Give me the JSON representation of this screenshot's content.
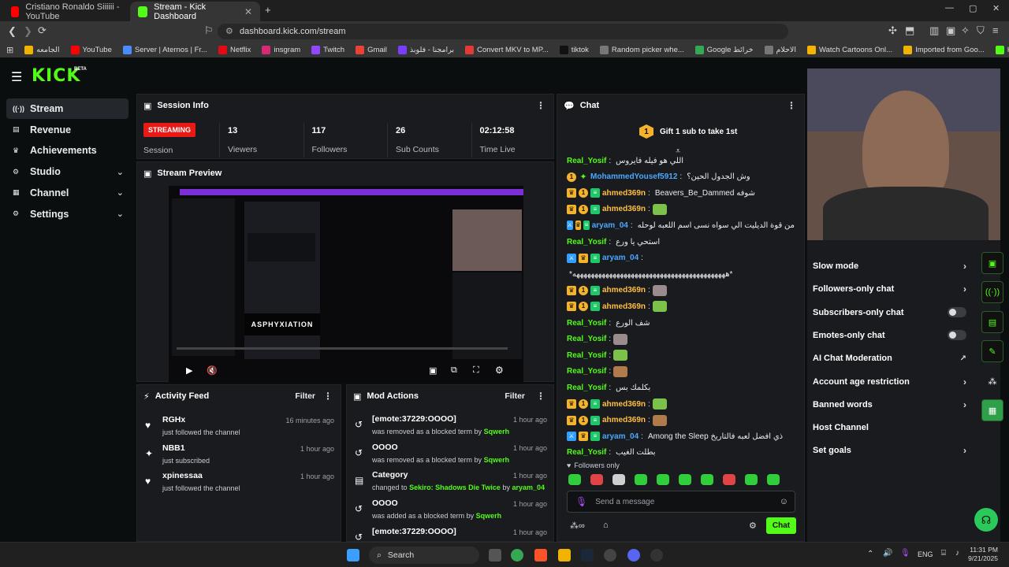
{
  "browser": {
    "tabs": [
      {
        "title": "Cristiano Ronaldo Siiiiii - YouTube",
        "active": false,
        "color": "#ff0000"
      },
      {
        "title": "Stream - Kick Dashboard",
        "active": true,
        "color": "#53fc18"
      }
    ],
    "new_tab": "+",
    "url": "dashboard.kick.com/stream",
    "bookmarks": [
      {
        "label": "الجامعه",
        "color": "#f0b400"
      },
      {
        "label": "YouTube",
        "color": "#ff0000"
      },
      {
        "label": "Server | Aternos | Fr...",
        "color": "#4a8cff"
      },
      {
        "label": "Netflix",
        "color": "#e50914"
      },
      {
        "label": "insgram",
        "color": "#d62976"
      },
      {
        "label": "Twitch",
        "color": "#9146ff"
      },
      {
        "label": "Gmail",
        "color": "#ea4335"
      },
      {
        "label": "برامجنا - فلوبذ",
        "color": "#7a3cff"
      },
      {
        "label": "Convert MKV to MP...",
        "color": "#e53935"
      },
      {
        "label": "tiktok",
        "color": "#111111"
      },
      {
        "label": "Random picker whe...",
        "color": "#777777"
      },
      {
        "label": "Google خرائط",
        "color": "#34a853"
      },
      {
        "label": "الاحلام",
        "color": "#777777"
      },
      {
        "label": "Watch Cartoons Onl...",
        "color": "#f4b400"
      },
      {
        "label": "Imported from Goo...",
        "color": "#f0b400"
      },
      {
        "label": "Kick",
        "color": "#53fc18"
      }
    ]
  },
  "app": {
    "logo": "KICK",
    "logo_badge": "BETA",
    "nav": [
      {
        "label": "Stream",
        "icon": "stream-icon",
        "active": true,
        "expandable": false
      },
      {
        "label": "Revenue",
        "icon": "revenue-icon",
        "active": false,
        "expandable": false
      },
      {
        "label": "Achievements",
        "icon": "trophy-icon",
        "active": false,
        "expandable": false
      },
      {
        "label": "Studio",
        "icon": "studio-icon",
        "active": false,
        "expandable": true
      },
      {
        "label": "Channel",
        "icon": "channel-icon",
        "active": false,
        "expandable": true
      },
      {
        "label": "Settings",
        "icon": "gear-icon",
        "active": false,
        "expandable": true
      }
    ],
    "session": {
      "title": "Session Info",
      "status": "STREAMING",
      "status_label": "Session",
      "stats": [
        {
          "value": "13",
          "label": "Viewers"
        },
        {
          "value": "117",
          "label": "Followers"
        },
        {
          "value": "26",
          "label": "Sub Counts"
        },
        {
          "value": "02:12:58",
          "label": "Time Live"
        }
      ]
    },
    "preview": {
      "title": "Stream Preview"
    },
    "activity": {
      "title": "Activity Feed",
      "filter": "Filter",
      "items": [
        {
          "name": "RGHx",
          "desc": "just followed the channel",
          "time": "16 minutes ago",
          "icon": "heart-icon"
        },
        {
          "name": "NBB1",
          "desc": "just subscribed",
          "time": "1 hour ago",
          "icon": "star-icon"
        },
        {
          "name": "xpinessaa",
          "desc": "just followed the channel",
          "time": "1 hour ago",
          "icon": "heart-icon"
        }
      ]
    },
    "mod": {
      "title": "Mod Actions",
      "filter": "Filter",
      "items": [
        {
          "title": "[emote:37229:OOOO]",
          "pre": "was removed as a blocked term by",
          "hl": "",
          "mid": "",
          "user": "Sqwerh",
          "time": "1 hour ago",
          "icon": "undo-icon"
        },
        {
          "title": "OOOO",
          "pre": "was removed as a blocked term by",
          "hl": "",
          "mid": "",
          "user": "Sqwerh",
          "time": "1 hour ago",
          "icon": "undo-icon"
        },
        {
          "title": "Category",
          "pre": "changed to",
          "hl": "Sekiro: Shadows Die Twice",
          "mid": "by",
          "user": "aryam_04",
          "time": "1 hour ago",
          "icon": "category-icon"
        },
        {
          "title": "OOOO",
          "pre": "was added as a blocked term by",
          "hl": "",
          "mid": "",
          "user": "Sqwerh",
          "time": "1 hour ago",
          "icon": "undo-icon"
        },
        {
          "title": "[emote:37229:OOOO]",
          "pre": "",
          "hl": "",
          "mid": "",
          "user": "",
          "time": "1 hour ago",
          "icon": "undo-icon"
        }
      ]
    },
    "chat": {
      "title": "Chat",
      "pinned_num": "1",
      "pinned": "Gift 1 sub to take 1st",
      "followers_only": "Followers only",
      "placeholder": "Send a message",
      "send": "Chat",
      "messages": [
        {
          "user": "Real_Yosif",
          "color": "#53fc18",
          "badges": [],
          "text": "اللي هو فيله فايروس",
          "emotes": 0
        },
        {
          "user": "MohammedYousef5912",
          "color": "#4aa8ff",
          "badges": [
            "gold",
            "sparkle"
          ],
          "text": "وش الجدول الحين؟",
          "emotes": 0
        },
        {
          "user": "ahmed369n",
          "color": "#ffbf3f",
          "badges": [
            "vip",
            "gold",
            "sub"
          ],
          "text": "Beavers_Be_Dammed شوفه",
          "emotes": 0
        },
        {
          "user": "ahmed369n",
          "color": "#ffbf3f",
          "badges": [
            "vip",
            "gold",
            "sub"
          ],
          "text": "",
          "emotes": 1
        },
        {
          "user": "aryam_04",
          "color": "#4aa8ff",
          "badges": [
            "mod",
            "vip",
            "sub"
          ],
          "text": "من قوة الديليت الي سواه نسى اسم اللعبه لوحله",
          "emotes": 0
        },
        {
          "user": "Real_Yosif",
          "color": "#53fc18",
          "badges": [],
          "text": "استحي يا ورع",
          "emotes": 0
        },
        {
          "user": "aryam_04",
          "color": "#4aa8ff",
          "badges": [
            "mod",
            "vip",
            "sub"
          ],
          "text": "",
          "emotes": 0
        },
        {
          "user": "",
          "color": "#e9ecef",
          "badges": [],
          "text": "*ههههههههههههههههههههههههههههههههههههههههههه*",
          "emotes": 0
        },
        {
          "user": "ahmed369n",
          "color": "#ffbf3f",
          "badges": [
            "vip",
            "gold",
            "sub"
          ],
          "text": "",
          "emotes": 1
        },
        {
          "user": "ahmed369n",
          "color": "#ffbf3f",
          "badges": [
            "vip",
            "gold",
            "sub"
          ],
          "text": "",
          "emotes": 1
        },
        {
          "user": "Real_Yosif",
          "color": "#53fc18",
          "badges": [],
          "text": "شف الورع",
          "emotes": 0
        },
        {
          "user": "Real_Yosif",
          "color": "#53fc18",
          "badges": [],
          "text": "",
          "emotes": 1
        },
        {
          "user": "Real_Yosif",
          "color": "#53fc18",
          "badges": [],
          "text": "",
          "emotes": 1
        },
        {
          "user": "Real_Yosif",
          "color": "#53fc18",
          "badges": [],
          "text": "",
          "emotes": 1
        },
        {
          "user": "Real_Yosif",
          "color": "#53fc18",
          "badges": [],
          "text": "بكلمك بس",
          "emotes": 0
        },
        {
          "user": "ahmed369n",
          "color": "#ffbf3f",
          "badges": [
            "vip",
            "gold",
            "sub"
          ],
          "text": "",
          "emotes": 1
        },
        {
          "user": "ahmed369n",
          "color": "#ffbf3f",
          "badges": [
            "vip",
            "gold",
            "sub"
          ],
          "text": "",
          "emotes": 1
        },
        {
          "user": "aryam_04",
          "color": "#4aa8ff",
          "badges": [
            "mod",
            "vip",
            "sub"
          ],
          "text": "Among the Sleep ذي افضل لعبه فالتاريخ",
          "emotes": 0
        },
        {
          "user": "Real_Yosif",
          "color": "#53fc18",
          "badges": [],
          "text": "بطلت الغيب",
          "emotes": 0
        }
      ]
    },
    "chat_settings": [
      {
        "label": "Slow mode",
        "control": "arrow"
      },
      {
        "label": "Followers-only chat",
        "control": "arrow"
      },
      {
        "label": "Subscribers-only chat",
        "control": "toggle"
      },
      {
        "label": "Emotes-only chat",
        "control": "toggle"
      },
      {
        "label": "AI Chat Moderation",
        "control": "external"
      },
      {
        "label": "Account age restriction",
        "control": "arrow"
      },
      {
        "label": "Banned words",
        "control": "arrow"
      },
      {
        "label": "Host Channel",
        "control": "none"
      },
      {
        "label": "Set goals",
        "control": "arrow"
      }
    ]
  },
  "taskbar": {
    "search": "Search",
    "lang": "ENG",
    "time": "11:31 PM",
    "date": "9/21/2025"
  }
}
